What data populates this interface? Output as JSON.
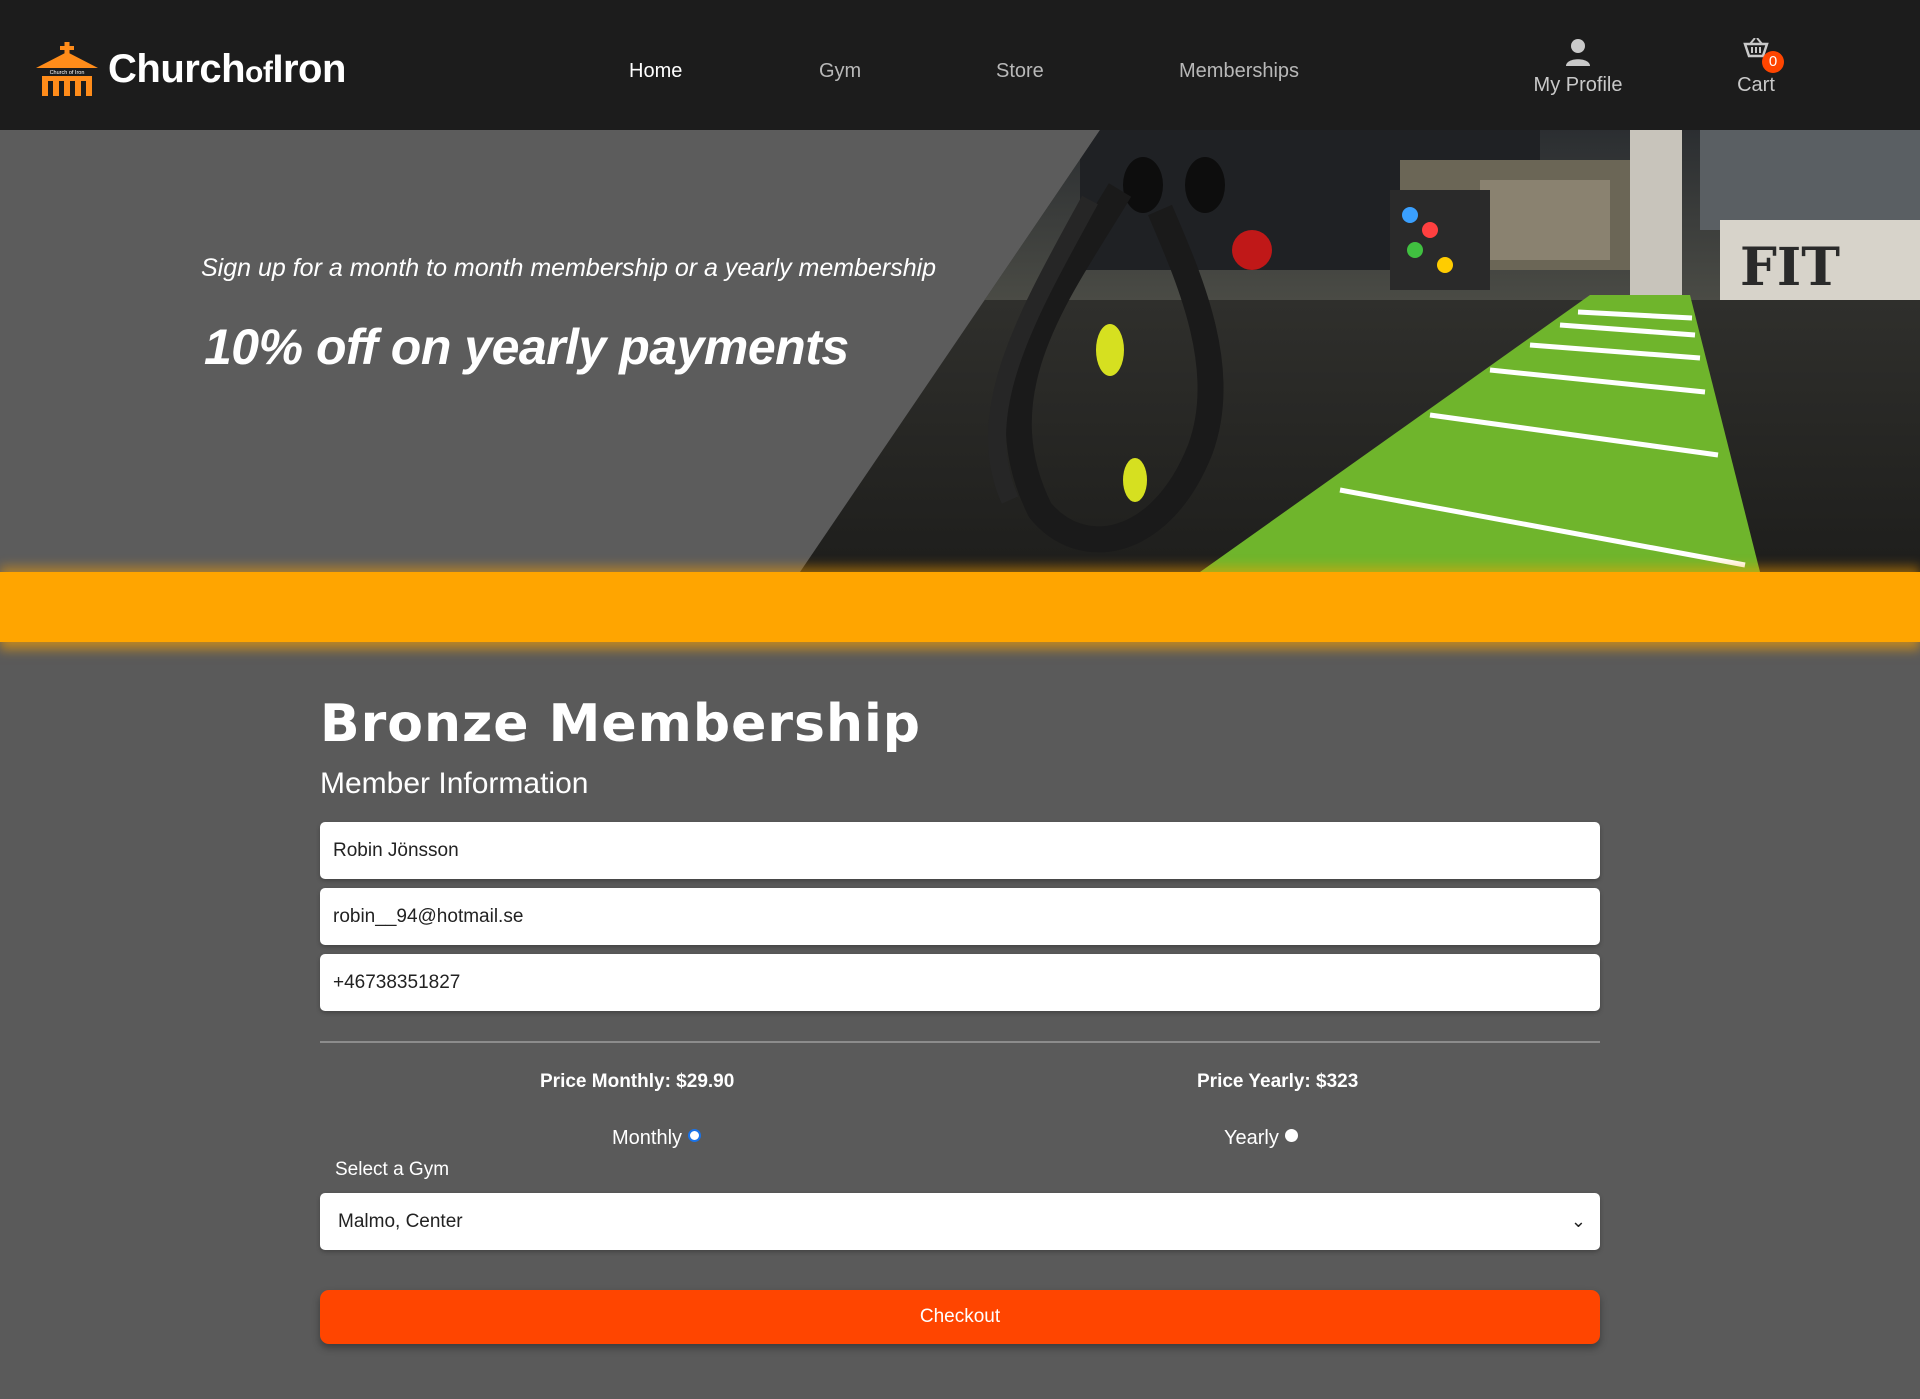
{
  "brand": {
    "name_part1": "Church",
    "name_part2": "of",
    "name_part3": "Iron",
    "logo_text": "Church of Iron",
    "accent": "#ff8c1a"
  },
  "nav": {
    "links": [
      {
        "label": "Home",
        "active": true
      },
      {
        "label": "Gym",
        "active": false
      },
      {
        "label": "Store",
        "active": false
      },
      {
        "label": "Memberships",
        "active": false
      }
    ],
    "profile": {
      "label": "My Profile",
      "icon": "user-icon"
    },
    "cart": {
      "label": "Cart",
      "count": "0",
      "icon": "cart-icon"
    }
  },
  "hero": {
    "subtitle": "Sign up for a month to month membership or a yearly membership",
    "title": "10% off on yearly payments",
    "photo_sign": "FIT"
  },
  "form": {
    "plan_title": "Bronze Membership",
    "section_title": "Member Information",
    "name_value": "Robin Jönsson",
    "email_value": "robin__94@hotmail.se",
    "phone_value": "+46738351827",
    "price_monthly": "Price Monthly: $29.90",
    "price_yearly": "Price Yearly: $323",
    "option_monthly": "Monthly",
    "option_yearly": "Yearly",
    "selected_option": "Monthly",
    "gym_label": "Select a Gym",
    "gym_selected": "Malmo, Center",
    "checkout_label": "Checkout"
  },
  "colors": {
    "navbar": "#1c1c1c",
    "background": "#5a5a5a",
    "band": "#ffa500",
    "button": "#ff4500",
    "turf": "#6fb52c"
  }
}
